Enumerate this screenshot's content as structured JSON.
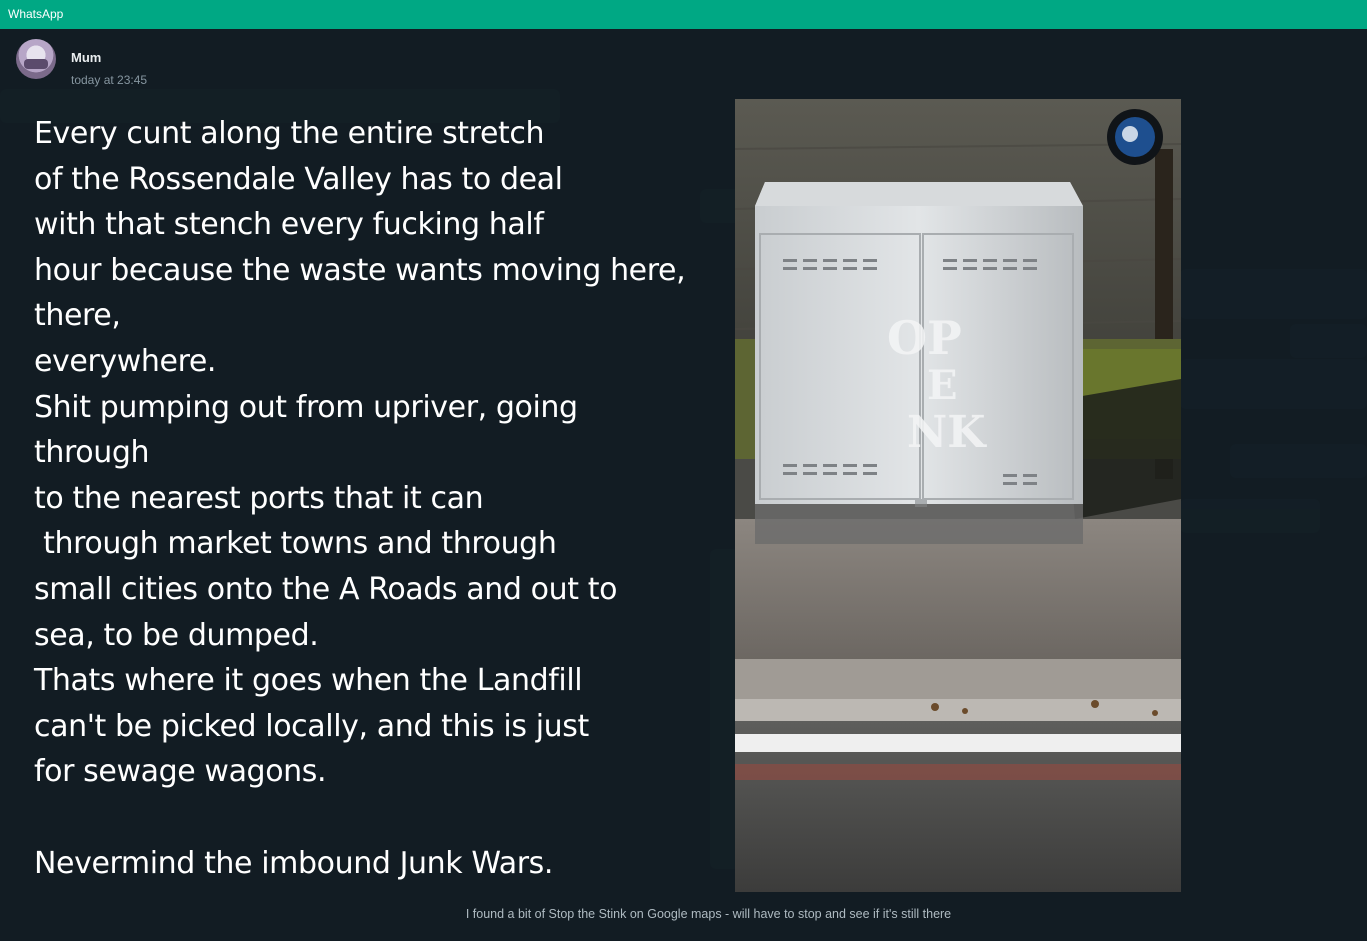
{
  "window": {
    "title": "WhatsApp"
  },
  "header": {
    "sender_name": "Mum",
    "timestamp": "today at 23:45"
  },
  "media": {
    "text_lines": [
      "Every cunt along the entire stretch",
      "of the Rossendale Valley has to deal",
      "with that stench every fucking half",
      "hour because the waste wants moving here,",
      "there,",
      "everywhere.",
      "Shit pumping out from upriver, going",
      "through",
      "to the nearest ports that it can",
      " through market towns and through",
      "small cities onto the A Roads and out to",
      "sea, to be dumped.",
      "Thats where it goes when the Landfill",
      "can't be picked locally, and this is just",
      "for sewage wagons.",
      "",
      "Nevermind the imbound Junk Wars."
    ],
    "stencil_text": [
      "OP",
      "E",
      "NK"
    ],
    "caption": "I found a bit of Stop the Stink on Google maps - will have to stop and see if it's still there"
  },
  "colors": {
    "accent": "#00a884",
    "background": "#121c23",
    "text_primary": "#e9edef",
    "text_secondary": "#8696a0"
  }
}
